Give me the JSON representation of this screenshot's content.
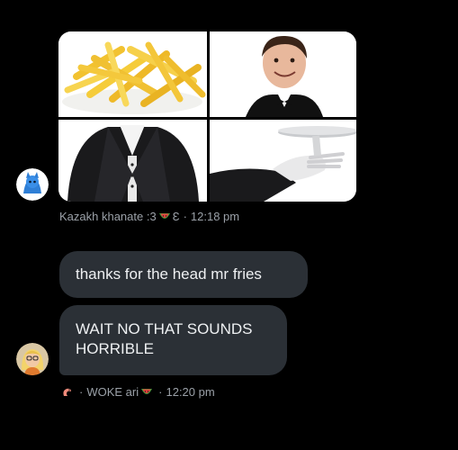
{
  "colors": {
    "background": "#000000",
    "bubble": "#2b3036",
    "bubble_text": "#eef0f2",
    "meta_text": "#9ba1a8",
    "watermelon": "#e8413c"
  },
  "attachment": {
    "panels": [
      {
        "name": "fries-image",
        "icon": "french-fries"
      },
      {
        "name": "waiter-head-image",
        "icon": "smiling-man-head"
      },
      {
        "name": "tuxedo-body-image",
        "icon": "tuxedo-torso"
      },
      {
        "name": "serving-tray-image",
        "icon": "gloved-hand-tray"
      }
    ]
  },
  "messages": [
    {
      "author": "Kazakh khanate :3",
      "author_emoji": "watermelon-icon",
      "author_suffix": "Ɛ",
      "time": "12:18 pm",
      "avatar_icon": "blue-cartoon-avatar"
    }
  ],
  "bubbles": [
    {
      "text": "thanks for the head mr fries"
    },
    {
      "text": "WAIT NO THAT SOUNDS HORRIBLE"
    }
  ],
  "reply_meta": {
    "prefix_emoji": "shrimp-icon",
    "author": "WOKE ari",
    "author_emoji": "watermelon-icon",
    "time": "12:20 pm",
    "avatar_icon": "cartoon-girl-avatar"
  }
}
